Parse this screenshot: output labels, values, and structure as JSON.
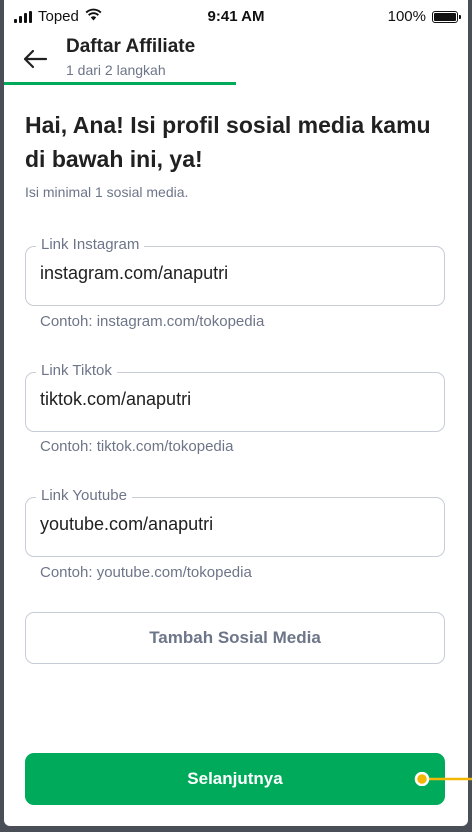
{
  "status_bar": {
    "carrier": "Toped",
    "time": "9:41 AM",
    "battery": "100%"
  },
  "header": {
    "title": "Daftar Affiliate",
    "step": "1 dari 2 langkah",
    "progress": 0.5
  },
  "heading": "Hai, Ana! Isi profil sosial media kamu di bawah ini, ya!",
  "subheading": "Isi minimal 1 sosial media.",
  "fields": [
    {
      "label": "Link Instagram",
      "value": "instagram.com/anaputri",
      "hint": "Contoh: instagram.com/tokopedia"
    },
    {
      "label": "Link Tiktok",
      "value": "tiktok.com/anaputri",
      "hint": "Contoh: tiktok.com/tokopedia"
    },
    {
      "label": "Link Youtube",
      "value": "youtube.com/anaputri",
      "hint": "Contoh: youtube.com/tokopedia"
    }
  ],
  "add_button": "Tambah Sosial Media",
  "next_button": "Selanjutnya",
  "colors": {
    "primary": "#00aa5b",
    "annotation": "#f2b705",
    "text": "#212121",
    "muted": "#6d7588",
    "border": "#c7ccd6"
  }
}
